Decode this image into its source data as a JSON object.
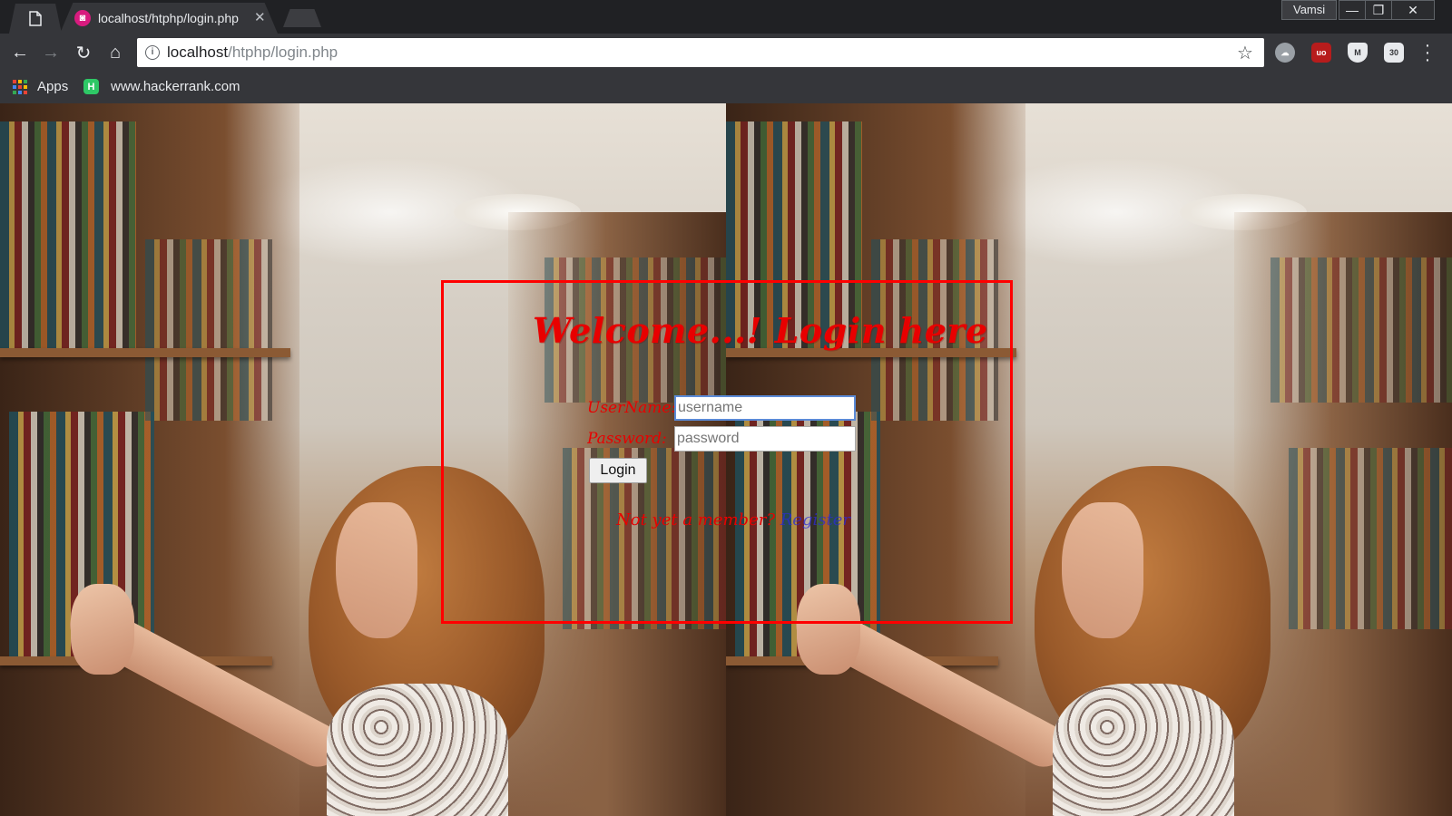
{
  "browser": {
    "tab": {
      "title": "localhost/htphp/login.php",
      "favicon_color": "#d81b7f",
      "close_icon": "close-icon"
    },
    "profile_name": "Vamsi",
    "window_buttons": {
      "minimize": "—",
      "restore": "❐",
      "close": "✕"
    },
    "nav": {
      "back": "←",
      "forward": "→",
      "reload": "↻",
      "home": "⌂"
    },
    "address": {
      "host": "localhost",
      "path": "/htphp/login.php",
      "info_icon": "info-icon",
      "star_icon": "star-icon"
    },
    "extensions": [
      "cloud-extension-icon",
      "ublock-icon",
      "shield-extension-icon",
      "tabs-extension-icon"
    ],
    "bookmarks": [
      {
        "label": "Apps",
        "icon": "apps-grid-icon"
      },
      {
        "label": "www.hackerrank.com",
        "icon": "hackerrank-icon"
      }
    ]
  },
  "login": {
    "heading": "Welcome...! Login here",
    "username_label": "UserName:",
    "username_placeholder": "username",
    "password_label": "Password:",
    "password_placeholder": "password",
    "login_button": "Login",
    "member_prompt": "Not yet a member?",
    "register_link": "Register"
  },
  "colors": {
    "accent_red": "#ff0000",
    "link_blue": "#2b2bd4",
    "chrome_dark": "#202124",
    "chrome_toolbar": "#35363a"
  }
}
